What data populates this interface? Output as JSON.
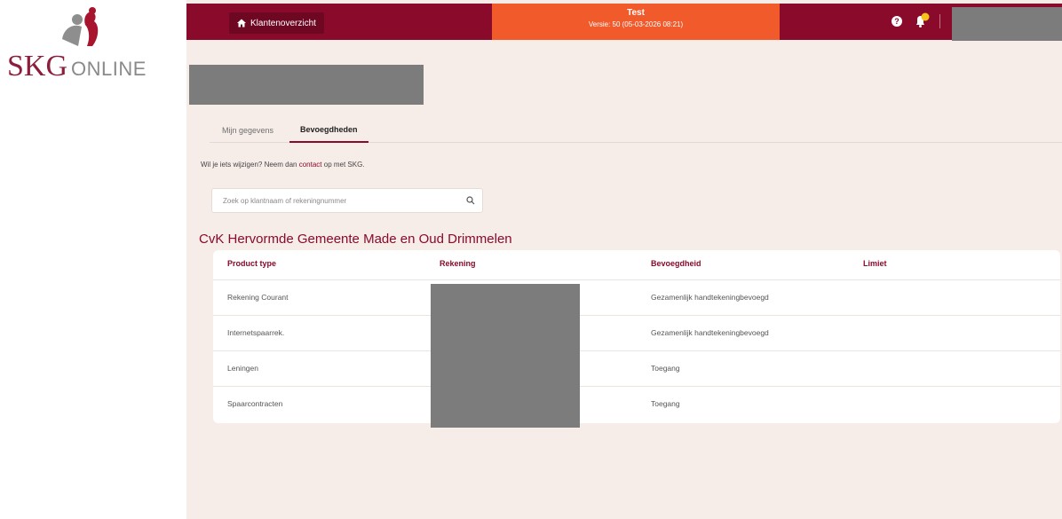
{
  "brand": {
    "logo_text_primary": "SKG",
    "logo_text_secondary": "ONLINE",
    "color_primary": "#8a0a2b",
    "color_accent": "#f15a2b"
  },
  "topbar": {
    "home_label": "Klantenoverzicht",
    "env_name": "Test",
    "env_version": "Versie: 50 (05-03-2026 08:21)",
    "help_glyph": "?"
  },
  "tabs": [
    {
      "label": "Mijn gegevens",
      "active": false
    },
    {
      "label": "Bevoegdheden",
      "active": true
    }
  ],
  "info": {
    "prefix": "Wil je iets wijzigen? Neem dan ",
    "link": "contact",
    "suffix": " op met SKG."
  },
  "search": {
    "placeholder": "Zoek op klantnaam of rekeningnummer",
    "value": ""
  },
  "organization": "CvK Hervormde Gemeente Made en Oud Drimmelen",
  "table": {
    "headers": [
      "Product type",
      "Rekening",
      "Bevoegdheid",
      "Limiet"
    ],
    "rows": [
      {
        "product": "Rekening Courant",
        "account": "",
        "authority": "Gezamenlijk handtekeningbevoegd",
        "limit": ""
      },
      {
        "product": "Internetspaarrek.",
        "account": "",
        "authority": "Gezamenlijk handtekeningbevoegd",
        "limit": ""
      },
      {
        "product": "Leningen",
        "account": "",
        "authority": "Toegang",
        "limit": ""
      },
      {
        "product": "Spaarcontracten",
        "account": "",
        "authority": "Toegang",
        "limit": ""
      }
    ]
  }
}
